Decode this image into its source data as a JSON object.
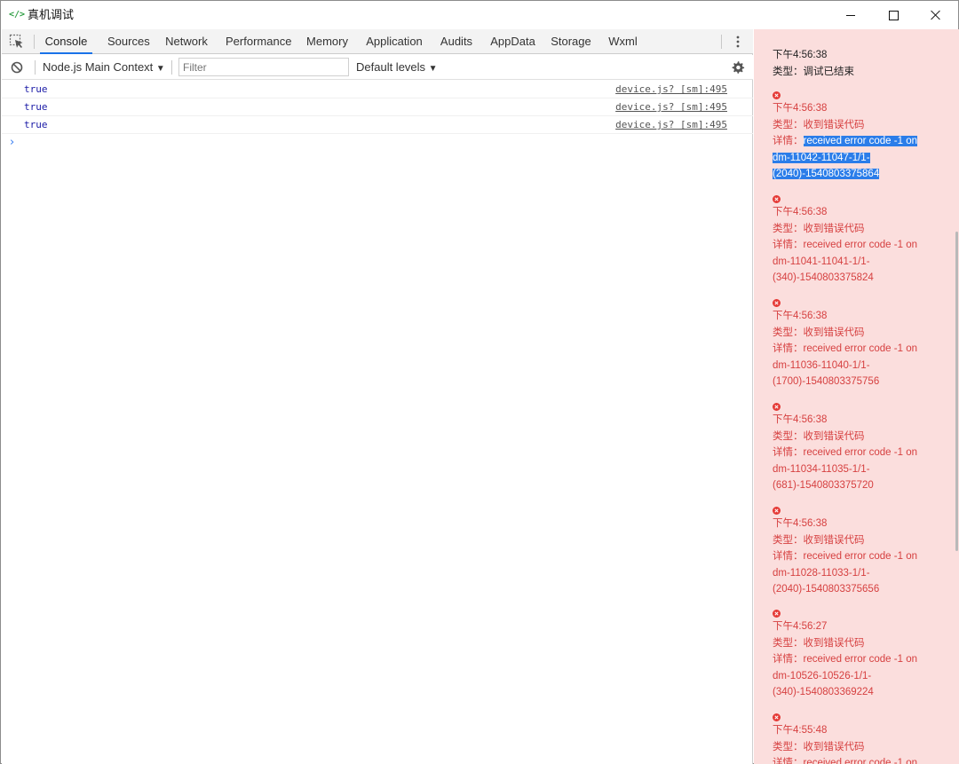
{
  "window": {
    "icon_text": "</>",
    "title": "真机调试"
  },
  "devtools": {
    "tabs": [
      {
        "label": "Console",
        "active": true
      },
      {
        "label": "Sources"
      },
      {
        "label": "Network"
      },
      {
        "label": "Performance"
      },
      {
        "label": "Memory"
      },
      {
        "label": "Application"
      },
      {
        "label": "Audits"
      },
      {
        "label": "AppData"
      },
      {
        "label": "Storage"
      },
      {
        "label": "Wxml"
      }
    ],
    "filterbar": {
      "context": "Node.js Main Context",
      "filter_placeholder": "Filter",
      "levels": "Default levels"
    },
    "console": {
      "rows": [
        {
          "value": "true",
          "source": "device.js? [sm]:495"
        },
        {
          "value": "true",
          "source": "device.js? [sm]:495"
        },
        {
          "value": "true",
          "source": "device.js? [sm]:495"
        }
      ],
      "prompt": "›"
    },
    "accent_color": "#1a73e8"
  },
  "side_panel": {
    "background": "#fbdedd",
    "error_color": "#d64040",
    "entries": [
      {
        "time": "下午4:56:38",
        "type": "类型：调试已结束"
      },
      {
        "time": "下午4:56:38",
        "type": "类型：收到错误代码",
        "detail_label": "详情：",
        "detail_lines": [
          "received error code -1 on",
          "dm-11042-11047-1/1-",
          "(2040)-1540803375864"
        ]
      },
      {
        "time": "下午4:56:38",
        "type": "类型：收到错误代码",
        "detail_label": "详情：",
        "detail_lines": [
          "received error code -1 on",
          "dm-11041-11041-1/1-",
          "(340)-1540803375824"
        ]
      },
      {
        "time": "下午4:56:38",
        "type": "类型：收到错误代码",
        "detail_label": "详情：",
        "detail_lines": [
          "received error code -1 on",
          "dm-11036-11040-1/1-",
          "(1700)-1540803375756"
        ]
      },
      {
        "time": "下午4:56:38",
        "type": "类型：收到错误代码",
        "detail_label": "详情：",
        "detail_lines": [
          "received error code -1 on",
          "dm-11034-11035-1/1-",
          "(681)-1540803375720"
        ]
      },
      {
        "time": "下午4:56:38",
        "type": "类型：收到错误代码",
        "detail_label": "详情：",
        "detail_lines": [
          "received error code -1 on",
          "dm-11028-11033-1/1-",
          "(2040)-1540803375656"
        ]
      },
      {
        "time": "下午4:56:27",
        "type": "类型：收到错误代码",
        "detail_label": "详情：",
        "detail_lines": [
          "received error code -1 on",
          "dm-10526-10526-1/1-",
          "(340)-1540803369224"
        ]
      },
      {
        "time": "下午4:55:48",
        "type": "类型：收到错误代码",
        "detail_label": "详情：",
        "detail_lines": [
          "received error code -1 on"
        ]
      }
    ]
  }
}
